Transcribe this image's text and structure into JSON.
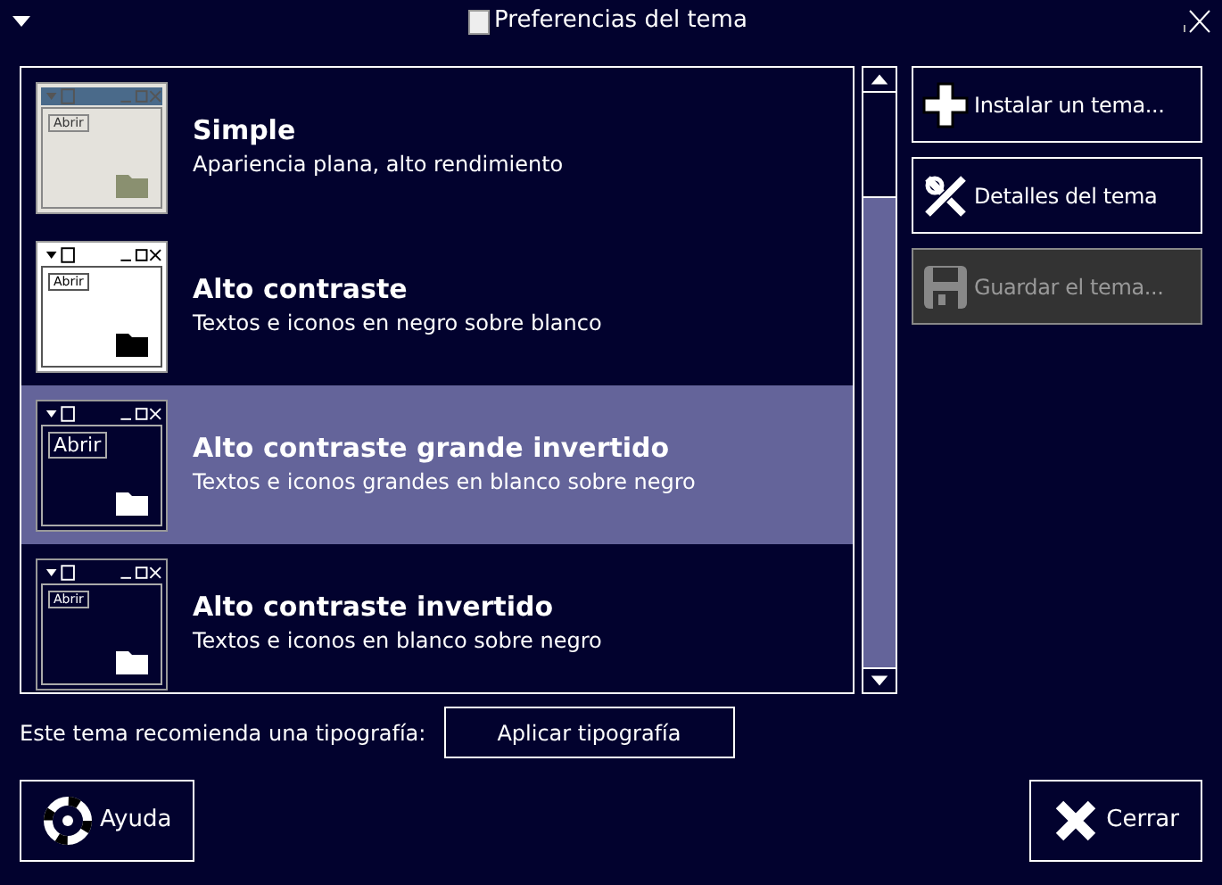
{
  "window": {
    "title": "Preferencias del tema"
  },
  "themes": [
    {
      "kind": "simple",
      "name": "Simple",
      "description": "Apariencia plana, alto rendimiento",
      "preview_button": "Abrir",
      "selected": false
    },
    {
      "kind": "contrast",
      "name": "Alto contraste",
      "description": "Textos e iconos en negro sobre blanco",
      "preview_button": "Abrir",
      "selected": false
    },
    {
      "kind": "large-inverted",
      "name": "Alto contraste grande invertido",
      "description": "Textos e iconos grandes en blanco sobre negro",
      "preview_button": "Abrir",
      "selected": true
    },
    {
      "kind": "inverted",
      "name": "Alto contraste invertido",
      "description": "Textos e iconos en blanco sobre negro",
      "preview_button": "Abrir",
      "selected": false
    }
  ],
  "actions": [
    {
      "kind": "install",
      "label": "Instalar un tema...",
      "disabled": false
    },
    {
      "kind": "details",
      "label": "Detalles del tema",
      "disabled": false
    },
    {
      "kind": "save",
      "label": "Guardar el tema...",
      "disabled": true
    }
  ],
  "font_hint": {
    "text": "Este tema recomienda una tipografía:",
    "button": "Aplicar tipografía"
  },
  "footer": [
    {
      "kind": "help",
      "label": "Ayuda"
    },
    {
      "kind": "close",
      "label": "Cerrar"
    }
  ]
}
